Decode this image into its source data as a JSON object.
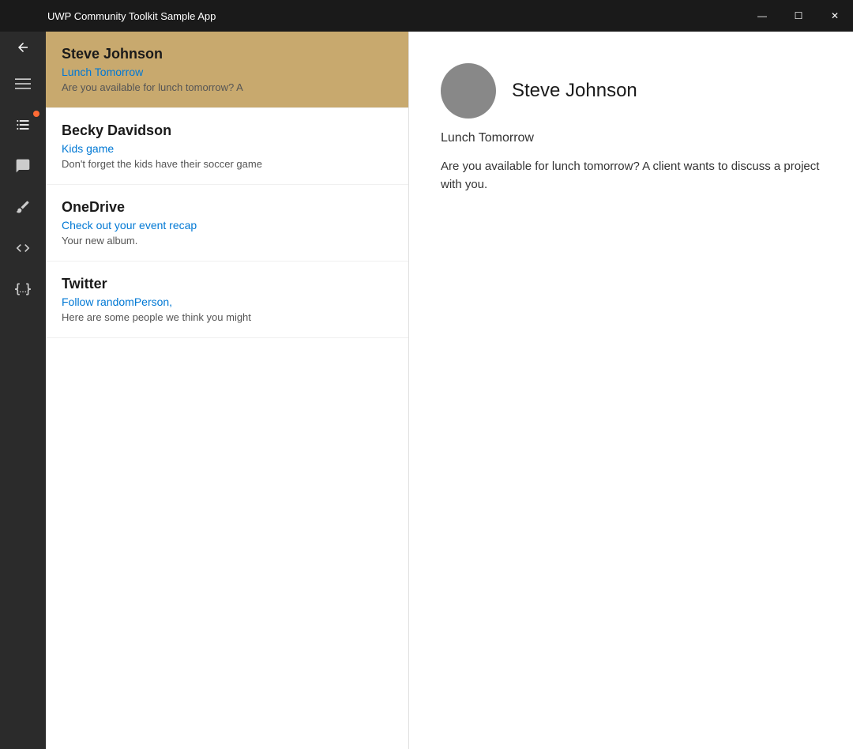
{
  "titleBar": {
    "title": "UWP Community Toolkit Sample App",
    "minimize": "—",
    "maximize": "☐",
    "close": "✕"
  },
  "sidebar": {
    "backIcon": "←",
    "items": [
      {
        "name": "menu-icon",
        "label": "Menu",
        "icon": "menu"
      },
      {
        "name": "checklist-icon",
        "label": "Checklist",
        "icon": "checklist",
        "active": true
      },
      {
        "name": "chat-icon",
        "label": "Chat",
        "icon": "chat"
      },
      {
        "name": "brush-icon",
        "label": "Brush",
        "icon": "brush"
      },
      {
        "name": "code-icon",
        "label": "Code",
        "icon": "code"
      },
      {
        "name": "json-icon",
        "label": "JSON",
        "icon": "json"
      }
    ]
  },
  "messageList": {
    "items": [
      {
        "id": "msg-1",
        "sender": "Steve Johnson",
        "subject": "Lunch Tomorrow",
        "preview": "Are you available for lunch tomorrow? A",
        "selected": true
      },
      {
        "id": "msg-2",
        "sender": "Becky Davidson",
        "subject": "Kids game",
        "preview": "Don't forget the kids have their soccer game",
        "selected": false
      },
      {
        "id": "msg-3",
        "sender": "OneDrive",
        "subject": "Check out your event recap",
        "preview": "Your new album.",
        "selected": false
      },
      {
        "id": "msg-4",
        "sender": "Twitter",
        "subject": "Follow randomPerson,",
        "preview": "Here are some people we think you might",
        "selected": false
      }
    ]
  },
  "detail": {
    "sender": "Steve Johnson",
    "subject": "Lunch Tomorrow",
    "body": "Are you available for lunch tomorrow? A client wants to discuss a project with you."
  }
}
